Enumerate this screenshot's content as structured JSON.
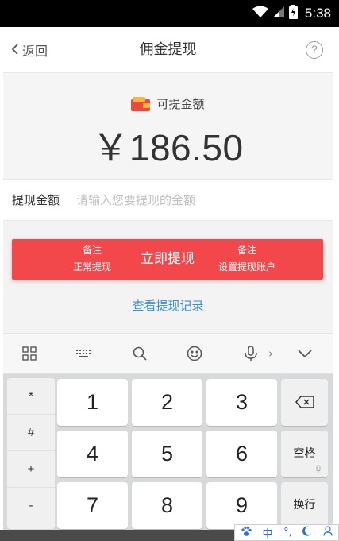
{
  "status_bar": {
    "time": "5:38"
  },
  "nav": {
    "back_label": "返回",
    "title": "佣金提现",
    "help_icon_text": "?"
  },
  "balance": {
    "label": "可提金额",
    "amount": "￥186.50"
  },
  "withdraw_form": {
    "amount_label": "提现金额",
    "amount_value": "",
    "amount_placeholder": "请输入您要提现的金额"
  },
  "withdraw_button": {
    "label": "立即提现",
    "left_note_title": "备注",
    "left_note_text": "正常提现",
    "right_note_title": "备注",
    "right_note_text": "设置提现账户"
  },
  "records_link": "查看提现记录",
  "ime_toolbar": {
    "items": [
      "grid-icon",
      "keyboard-icon",
      "search-icon",
      "emoji-icon",
      "microphone-icon",
      "collapse-chevron-icon"
    ],
    "more_glyph": "›"
  },
  "keyboard": {
    "symbols": [
      "*",
      "#",
      "+",
      "-"
    ],
    "digits": [
      "1",
      "2",
      "3",
      "4",
      "5",
      "6",
      "7",
      "8",
      "9"
    ],
    "space_label": "空格",
    "enter_label": "换行"
  },
  "ime_status": {
    "mode": "中",
    "punct": "°,",
    "items": [
      "paw-icon",
      "moon-icon",
      "user-icon"
    ]
  },
  "colors": {
    "accent": "#f2484c",
    "link": "#3a8cd0"
  }
}
